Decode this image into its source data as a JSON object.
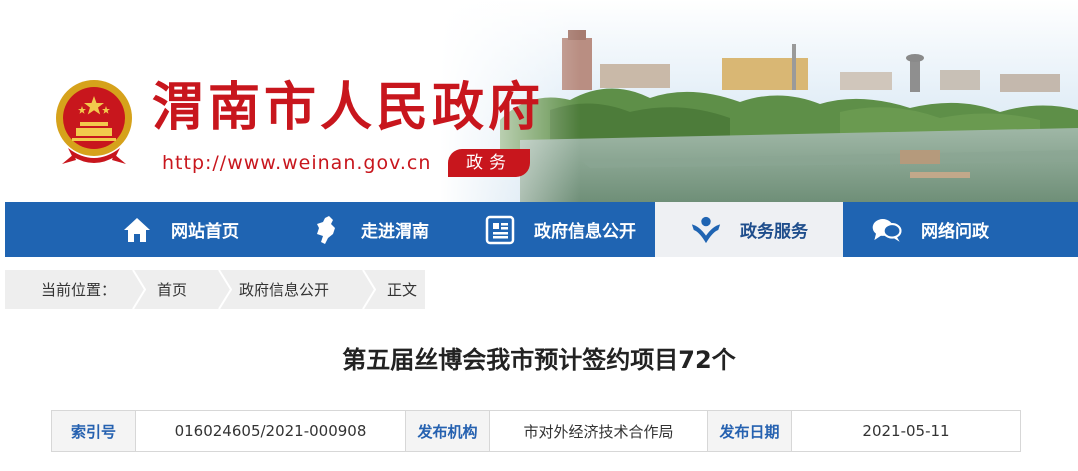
{
  "header": {
    "site_title": "渭南市人民政府",
    "site_url": "http://www.weinan.gov.cn",
    "site_tag": "政务",
    "brand_color": "#c8161d"
  },
  "nav": {
    "items": [
      {
        "label": "网站首页",
        "icon": "home-icon"
      },
      {
        "label": "走进渭南",
        "icon": "map-icon"
      },
      {
        "label": "政府信息公开",
        "icon": "document-icon"
      },
      {
        "label": "政务服务",
        "icon": "service-icon",
        "active": true
      },
      {
        "label": "网络问政",
        "icon": "chat-icon"
      }
    ],
    "bar_color": "#1f64b2"
  },
  "breadcrumb": {
    "prefix": "当前位置：",
    "items": [
      "首页",
      "政府信息公开",
      "正文"
    ]
  },
  "article": {
    "title": "第五届丝博会我市预计签约项目72个"
  },
  "meta": {
    "index_label": "索引号",
    "index_value": "016024605/2021-000908",
    "org_label": "发布机构",
    "org_value": "市对外经济技术合作局",
    "date_label": "发布日期",
    "date_value": "2021-05-11"
  }
}
